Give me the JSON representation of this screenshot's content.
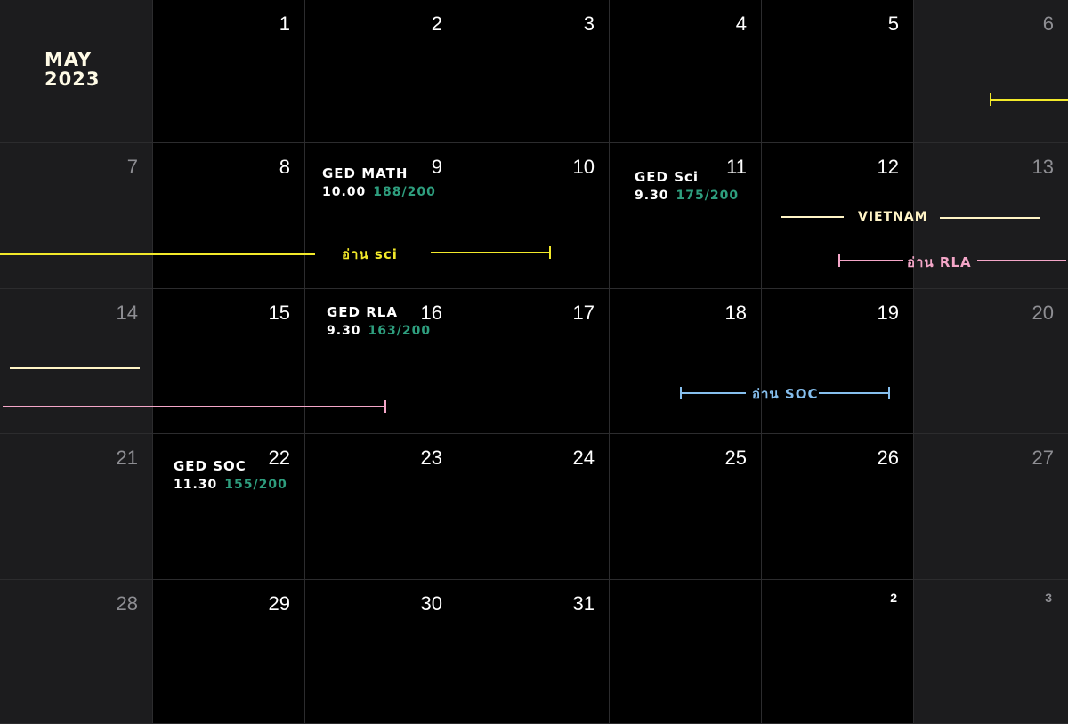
{
  "month_label": {
    "line1": "MAY",
    "line2": "2023"
  },
  "colors": {
    "yellow": "#f2e92a",
    "pink": "#f4a6c8",
    "cream": "#fff4c6",
    "blue": "#86bfee",
    "score_green": "#2e9e7e"
  },
  "weeks": [
    [
      "",
      "1",
      "2",
      "3",
      "4",
      "5",
      "6"
    ],
    [
      "7",
      "8",
      "9",
      "10",
      "11",
      "12",
      "13"
    ],
    [
      "14",
      "15",
      "16",
      "17",
      "18",
      "19",
      "20"
    ],
    [
      "21",
      "22",
      "23",
      "24",
      "25",
      "26",
      "27"
    ],
    [
      "28",
      "29",
      "30",
      "31",
      "",
      "2",
      "3"
    ]
  ],
  "exams": [
    {
      "title": "GED MATH",
      "time": "10.00",
      "score": "188/200"
    },
    {
      "title": "GED Sci",
      "time": "9.30",
      "score": "175/200"
    },
    {
      "title": "GED RLA",
      "time": "9.30",
      "score": "163/200"
    },
    {
      "title": "GED SOC",
      "time": "11.30",
      "score": "155/200"
    }
  ],
  "span_labels": {
    "read_sci": "อ่าน sci",
    "vietnam": "VIETNAM",
    "read_rla": "อ่าน RLA",
    "read_soc": "อ่าน SOC"
  }
}
